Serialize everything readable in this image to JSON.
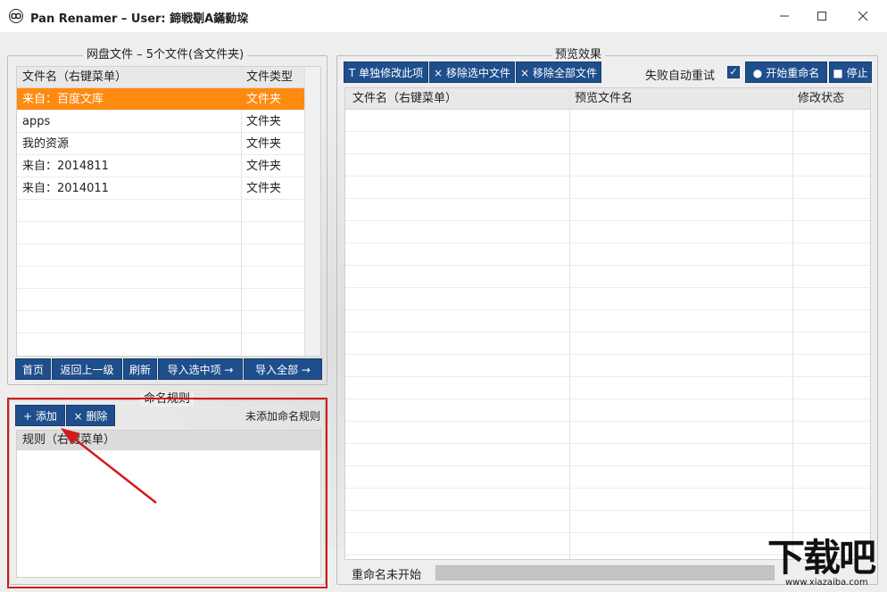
{
  "window": {
    "title": "Pan Renamer – User: 鍗戦劅A鏋勬垜",
    "app_icon": "baidu-cloud-icon"
  },
  "left_panel": {
    "title": "网盘文件 – 5个文件(含文件夹)",
    "columns": [
      "文件名（右键菜单）",
      "文件类型"
    ],
    "rows": [
      {
        "name": "来自：百度文库",
        "type": "文件夹",
        "selected": true
      },
      {
        "name": "apps",
        "type": "文件夹",
        "selected": false
      },
      {
        "name": "我的资源",
        "type": "文件夹",
        "selected": false
      },
      {
        "name": "来自：2014811",
        "type": "文件夹",
        "selected": false
      },
      {
        "name": "来自：2014011",
        "type": "文件夹",
        "selected": false
      }
    ],
    "buttons": {
      "home": "首页",
      "up": "返回上一级",
      "refresh": "刷新",
      "import_selected": "导入选中项 →",
      "import_all": "导入全部 →"
    }
  },
  "rules_panel": {
    "title": "命名规则",
    "add_label": "添加",
    "delete_label": "删除",
    "status": "未添加命名规则",
    "column": "规则（右键菜单）"
  },
  "preview_panel": {
    "title": "预览效果",
    "buttons": {
      "edit_single": "单独修改此项",
      "remove_selected": "移除选中文件",
      "remove_all": "移除全部文件",
      "start": "开始重命名",
      "stop": "停止"
    },
    "retry_label": "失败自动重试",
    "retry_checked": true,
    "columns": [
      "文件名（右键菜单）",
      "预览文件名",
      "修改状态"
    ],
    "status_text": "重命名未开始",
    "progress": 0
  },
  "watermark": {
    "main": "下载吧",
    "url": "www.xiazaiba.com"
  },
  "colors": {
    "accent": "#1f4e8c",
    "selection": "#ff8a10",
    "highlight": "#d11c1c"
  }
}
